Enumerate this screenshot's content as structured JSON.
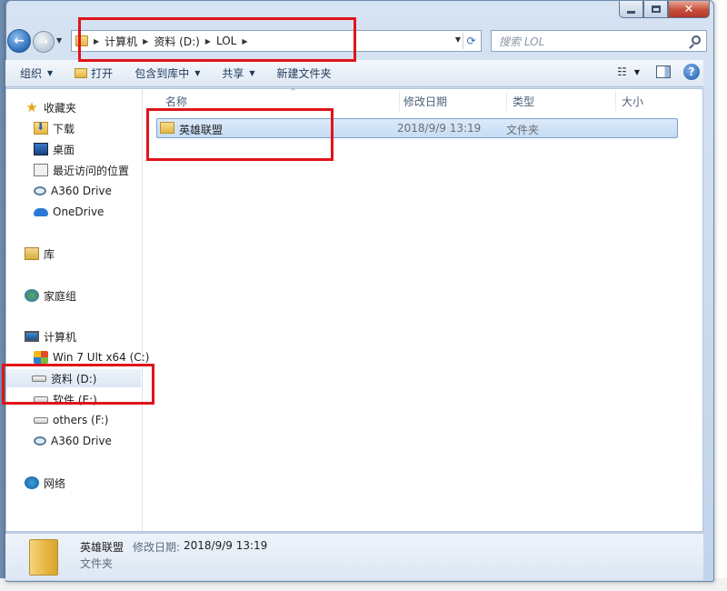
{
  "window": {
    "controls": {
      "minimize": "—",
      "close": "✕"
    }
  },
  "address_bar": {
    "breadcrumbs": [
      "计算机",
      "资料 (D:)",
      "LOL"
    ]
  },
  "search": {
    "placeholder": "搜索 LOL"
  },
  "toolbar": {
    "organize": "组织",
    "open": "打开",
    "include_in_library": "包含到库中",
    "share": "共享",
    "new_folder": "新建文件夹"
  },
  "nav_pane": {
    "favorites": {
      "label": "收藏夹",
      "items": [
        "下载",
        "桌面",
        "最近访问的位置",
        "A360 Drive",
        "OneDrive"
      ]
    },
    "libraries": "库",
    "homegroup": "家庭组",
    "computer": {
      "label": "计算机",
      "items": [
        "Win 7 Ult x64 (C:)",
        "资料 (D:)",
        "软件 (E:)",
        "others (F:)",
        "A360 Drive"
      ],
      "selected": "资料 (D:)"
    },
    "network": "网络"
  },
  "columns": {
    "name": "名称",
    "modified": "修改日期",
    "type": "类型",
    "size": "大小"
  },
  "files": [
    {
      "name": "英雄联盟",
      "modified": "2018/9/9 13:19",
      "type": "文件夹",
      "size": ""
    }
  ],
  "details_pane": {
    "name": "英雄联盟",
    "modified_label": "修改日期:",
    "modified_value": "2018/9/9 13:19",
    "type": "文件夹"
  },
  "colors": {
    "highlight_box": "#e0141a",
    "selection": "#c5dcf5"
  }
}
